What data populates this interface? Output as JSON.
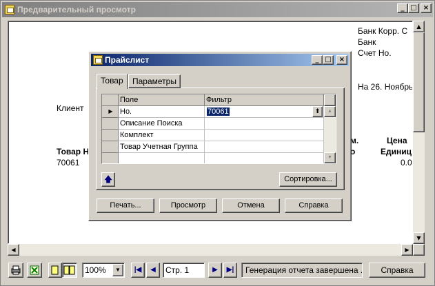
{
  "window": {
    "title": "Предварительный просмотр",
    "minimize": "_",
    "maximize": "□",
    "close": "×"
  },
  "report": {
    "bank_corr": "Банк Корр. С",
    "bank": "Банк",
    "account_no": "Счет Но.",
    "date_line": "На 26. Ноябрь",
    "client": "Клиент",
    "col_item_no": "Товар Н",
    "col_qty_suffix_top": "м.",
    "col_qty_suffix_bottom": "о",
    "col_price_top": "Цена",
    "col_price_bottom": "Единиц",
    "row_item_no": "70061",
    "row_price": "0.0"
  },
  "dialog": {
    "title": "Прайслист",
    "tabs": [
      {
        "label": "Товар"
      },
      {
        "label": "Параметры"
      }
    ],
    "grid": {
      "headers": {
        "field": "Поле",
        "filter": "Фильтр"
      },
      "rows": [
        {
          "field": "Но.",
          "filter": "70061"
        },
        {
          "field": "Описание Поиска",
          "filter": ""
        },
        {
          "field": "Комплект",
          "filter": ""
        },
        {
          "field": "Товар Учетная Группа",
          "filter": ""
        },
        {
          "field": "",
          "filter": ""
        }
      ]
    },
    "sort_button": "Сортировка...",
    "buttons": {
      "print": "Печать...",
      "preview": "Просмотр",
      "cancel": "Отмена",
      "help": "Справка"
    }
  },
  "toolbar": {
    "zoom": "100%",
    "page": "Стр. 1",
    "status": "Генерация отчета завершена ...",
    "help": "Справка"
  }
}
